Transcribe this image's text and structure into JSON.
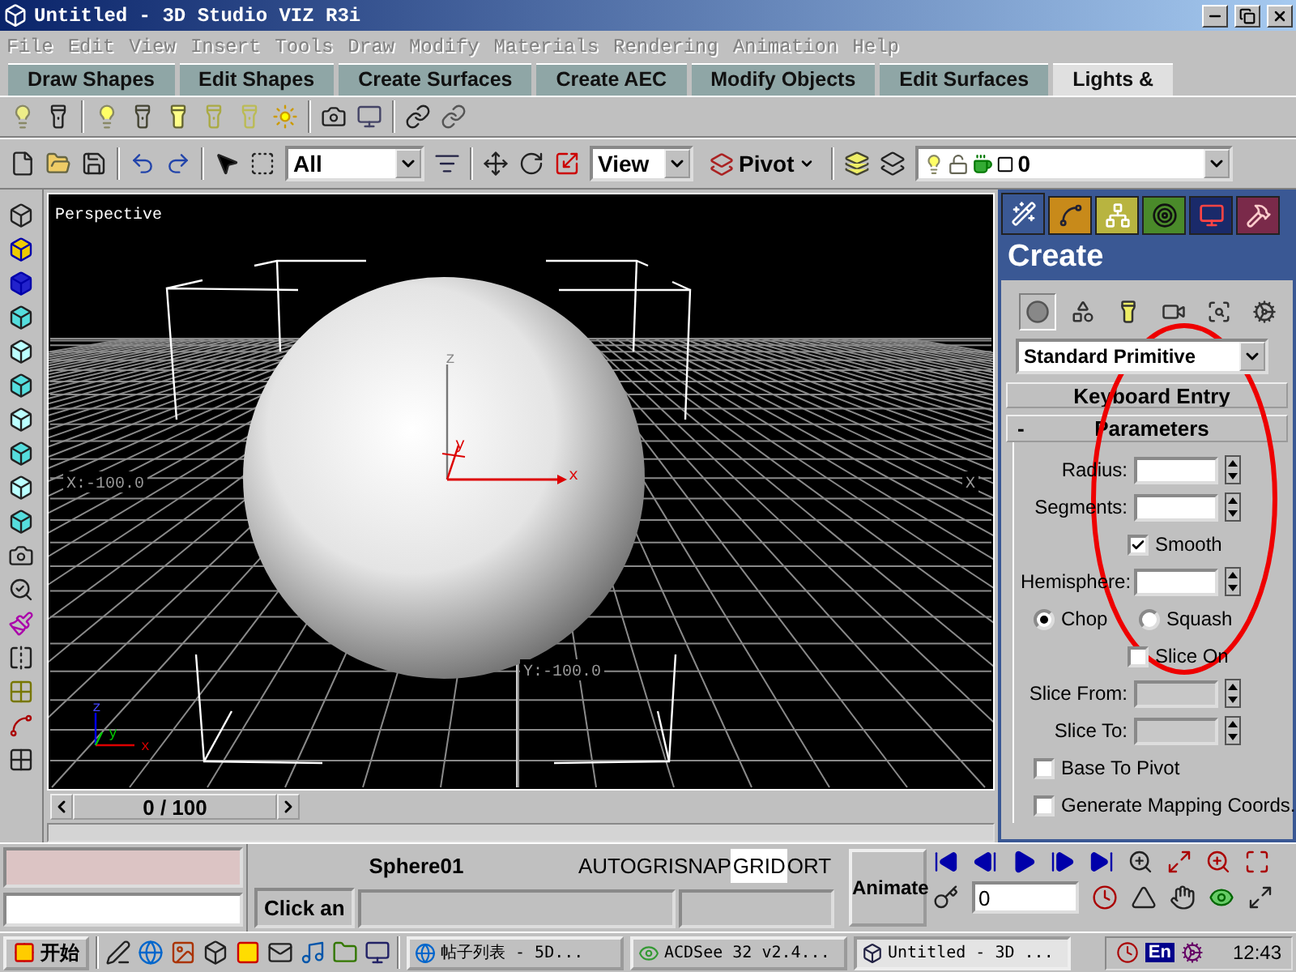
{
  "window": {
    "title": "Untitled - 3D Studio VIZ R3i"
  },
  "menu": [
    {
      "label": "File",
      "disabled": true
    },
    {
      "label": "Edit",
      "disabled": true
    },
    {
      "label": "View",
      "disabled": true
    },
    {
      "label": "Insert",
      "disabled": true
    },
    {
      "label": "Tools",
      "disabled": true
    },
    {
      "label": "Draw",
      "disabled": true
    },
    {
      "label": "Modify",
      "disabled": true
    },
    {
      "label": "Materials",
      "disabled": true
    },
    {
      "label": "Rendering",
      "disabled": true
    },
    {
      "label": "Animation",
      "disabled": true
    },
    {
      "label": "Help",
      "disabled": true
    }
  ],
  "tab_bar": [
    {
      "label": "Draw Shapes",
      "selected": false
    },
    {
      "label": "Edit Shapes",
      "selected": false
    },
    {
      "label": "Create Surfaces",
      "selected": false
    },
    {
      "label": "Create AEC",
      "selected": false
    },
    {
      "label": "Modify Objects",
      "selected": false
    },
    {
      "label": "Edit Surfaces",
      "selected": false
    },
    {
      "label": "Lights &",
      "selected": true
    }
  ],
  "main_toolbar": {
    "selection_filter": "All",
    "reference_coord": "View",
    "pivot": "Pivot",
    "layer": "0"
  },
  "viewport": {
    "label": "Perspective",
    "x_label_left": "X:-100.0",
    "x_label_right": "X",
    "y_label": "Y:-100.0",
    "gizmo_axes": [
      "z",
      "y",
      "x"
    ],
    "corner_axes": [
      "z",
      "y",
      "x"
    ]
  },
  "time_slider": {
    "position": "0 / 100"
  },
  "command_panel": {
    "tabs": [
      {
        "selected": true
      },
      {
        "selected": false
      },
      {
        "selected": false
      },
      {
        "selected": false
      },
      {
        "selected": false
      },
      {
        "selected": false
      }
    ],
    "title": "Create",
    "categories": [
      {
        "selected": true
      },
      {
        "selected": false
      },
      {
        "selected": false
      },
      {
        "selected": false
      },
      {
        "selected": false
      },
      {
        "selected": false
      }
    ],
    "object_type": "Standard Primitive",
    "rollouts": [
      {
        "title": "Keyboard Entry",
        "expanded": false
      },
      {
        "title": "Parameters",
        "toggle": "-",
        "expanded": true
      }
    ],
    "parameters": [
      {
        "kind": "spinner",
        "label": "Radius:",
        "disabled": false
      },
      {
        "kind": "spinner",
        "label": "Segments:",
        "disabled": false
      },
      {
        "kind": "inline_check",
        "label": "Smooth",
        "checked": true
      },
      {
        "kind": "spinner",
        "label": "Hemisphere:",
        "disabled": false
      },
      {
        "kind": "radios",
        "options": [
          {
            "label": "Chop",
            "selected": true
          },
          {
            "label": "Squash",
            "selected": false
          }
        ]
      },
      {
        "kind": "inline_check",
        "label": "Slice On",
        "checked": false
      },
      {
        "kind": "spinner",
        "label": "Slice From:",
        "disabled": true
      },
      {
        "kind": "spinner",
        "label": "Slice To:",
        "disabled": true
      },
      {
        "kind": "checkbox",
        "label": "Base To Pivot",
        "checked": false
      },
      {
        "kind": "checkbox",
        "label": "Generate Mapping Coords.",
        "checked": false
      }
    ]
  },
  "status": {
    "selection": "Sphere01",
    "modes": [
      {
        "label": "AUTOGRI",
        "on": false
      },
      {
        "label": "SNAP",
        "on": false
      },
      {
        "label": "GRID",
        "on": true
      },
      {
        "label": "ORT",
        "on": false
      }
    ],
    "prompt": "Click an",
    "animate": {
      "label": "Animate",
      "on": false
    },
    "frame": "0"
  },
  "taskbar": {
    "start": "开始",
    "tasks": [
      {
        "label": "帖子列表 - 5D...",
        "selected": false
      },
      {
        "label": "ACDSee 32 v2.4...",
        "selected": false
      },
      {
        "label": "Untitled - 3D ...",
        "selected": true
      }
    ],
    "language": "En",
    "clock": "12:43"
  }
}
